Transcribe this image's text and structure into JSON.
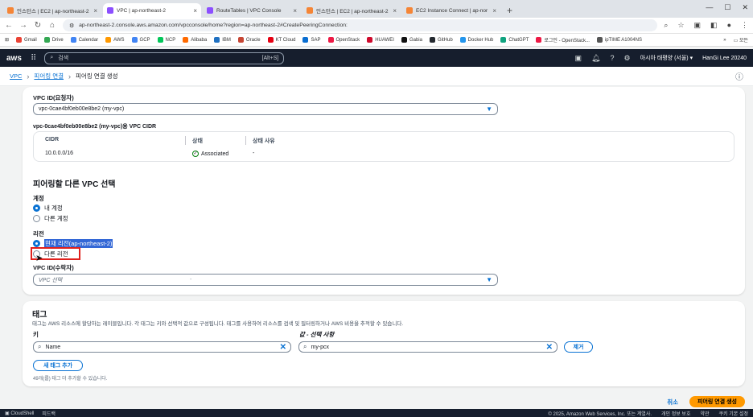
{
  "browser": {
    "tabs": [
      {
        "title": "인스턴스 | EC2 | ap-northeast-2",
        "color": "#f58536",
        "active": false
      },
      {
        "title": "VPC | ap-northeast-2",
        "color": "#8c4fff",
        "active": true
      },
      {
        "title": "RouteTables | VPC Console",
        "color": "#8c4fff",
        "active": false
      },
      {
        "title": "인스턴스 | EC2 | ap-northeast-2",
        "color": "#f58536",
        "active": false
      },
      {
        "title": "EC2 Instance Connect | ap-nor",
        "color": "#f58536",
        "active": false
      }
    ],
    "new_tab": "+",
    "url": "ap-northeast-2.console.aws.amazon.com/vpcconsole/home?region=ap-northeast-2#CreatePeeringConnection:",
    "bookmarks": [
      {
        "label": "Gmail",
        "color": "#ea4335"
      },
      {
        "label": "Drive",
        "color": "#34a853"
      },
      {
        "label": "Calendar",
        "color": "#4285f4"
      },
      {
        "label": "AWS",
        "color": "#ff9900"
      },
      {
        "label": "GCP",
        "color": "#4285f4"
      },
      {
        "label": "NCP",
        "color": "#03c75a"
      },
      {
        "label": "Alibaba",
        "color": "#ff6a00"
      },
      {
        "label": "IBM",
        "color": "#1f70c1"
      },
      {
        "label": "Oracle",
        "color": "#c74634"
      },
      {
        "label": "KT Cloud",
        "color": "#e60012"
      },
      {
        "label": "SAP",
        "color": "#0a6ed1"
      },
      {
        "label": "OpenStack",
        "color": "#ed1944"
      },
      {
        "label": "HUAWEI",
        "color": "#cf0a2c"
      },
      {
        "label": "Gabia",
        "color": "#111111"
      },
      {
        "label": "GitHub",
        "color": "#24292f"
      },
      {
        "label": "Docker Hub",
        "color": "#2496ed"
      },
      {
        "label": "ChatGPT",
        "color": "#10a37f"
      },
      {
        "label": "로그인 - OpenStack...",
        "color": "#ed1944"
      },
      {
        "label": "ipTIME A1004NS",
        "color": "#555555"
      }
    ],
    "bookmarks_more": "»",
    "bookmarks_folder": "모든"
  },
  "aws_header": {
    "logo": "aws",
    "search_placeholder": "검색",
    "search_shortcut": "[Alt+S]",
    "region": "아시아 태평양 (서울)",
    "user": "HanGi Lee 20240"
  },
  "breadcrumb": {
    "items": [
      "VPC",
      "피어링 연결",
      "피어링 연결 생성"
    ]
  },
  "form": {
    "requester_label": "VPC ID(요청자)",
    "requester_value": "vpc-0cae4bf0eb00e8be2 (my-vpc)",
    "cidr_caption": "vpc-0cae4bf0eb00e8be2 (my-vpc)용 VPC CIDR",
    "cidr_headers": [
      "CIDR",
      "상태",
      "상태 사유"
    ],
    "cidr_row": {
      "cidr": "10.0.0.0/16",
      "status": "Associated",
      "reason": "-"
    },
    "peer_section_title": "피어링할 다른 VPC 선택",
    "account_label": "계정",
    "account_options": [
      "내 계정",
      "다른 계정"
    ],
    "region_label": "리전",
    "region_options": [
      "현재 리전(ap-northeast-2)",
      "다른 리전"
    ],
    "accepter_label": "VPC ID(수락자)",
    "accepter_placeholder": "VPC 선택",
    "accepter_divider": "-"
  },
  "tags": {
    "title": "태그",
    "description": "태그는 AWS 리소스에 할당하는 레이블입니다. 각 태그는 키와 선택적 값으로 구성됩니다. 태그를 사용하여 리소스를 검색 및 필터링하거나 AWS 비용을 추적할 수 있습니다.",
    "key_label": "키",
    "value_label": "값 - 선택 사항",
    "key_value": "Name",
    "value_value": "my-pcx",
    "remove_label": "제거",
    "add_label": "새 태그 추가",
    "hint": "49개(를) 태그 더 추가할 수 있습니다."
  },
  "actions": {
    "cancel": "취소",
    "submit": "피어링 연결 생성"
  },
  "bottom_bar": {
    "left": [
      "CloudShell",
      "피드백"
    ],
    "right": [
      "© 2025, Amazon Web Services, Inc. 또는 계열사.",
      "개인 정보 보호",
      "약관",
      "쿠키 기본 설정"
    ]
  }
}
